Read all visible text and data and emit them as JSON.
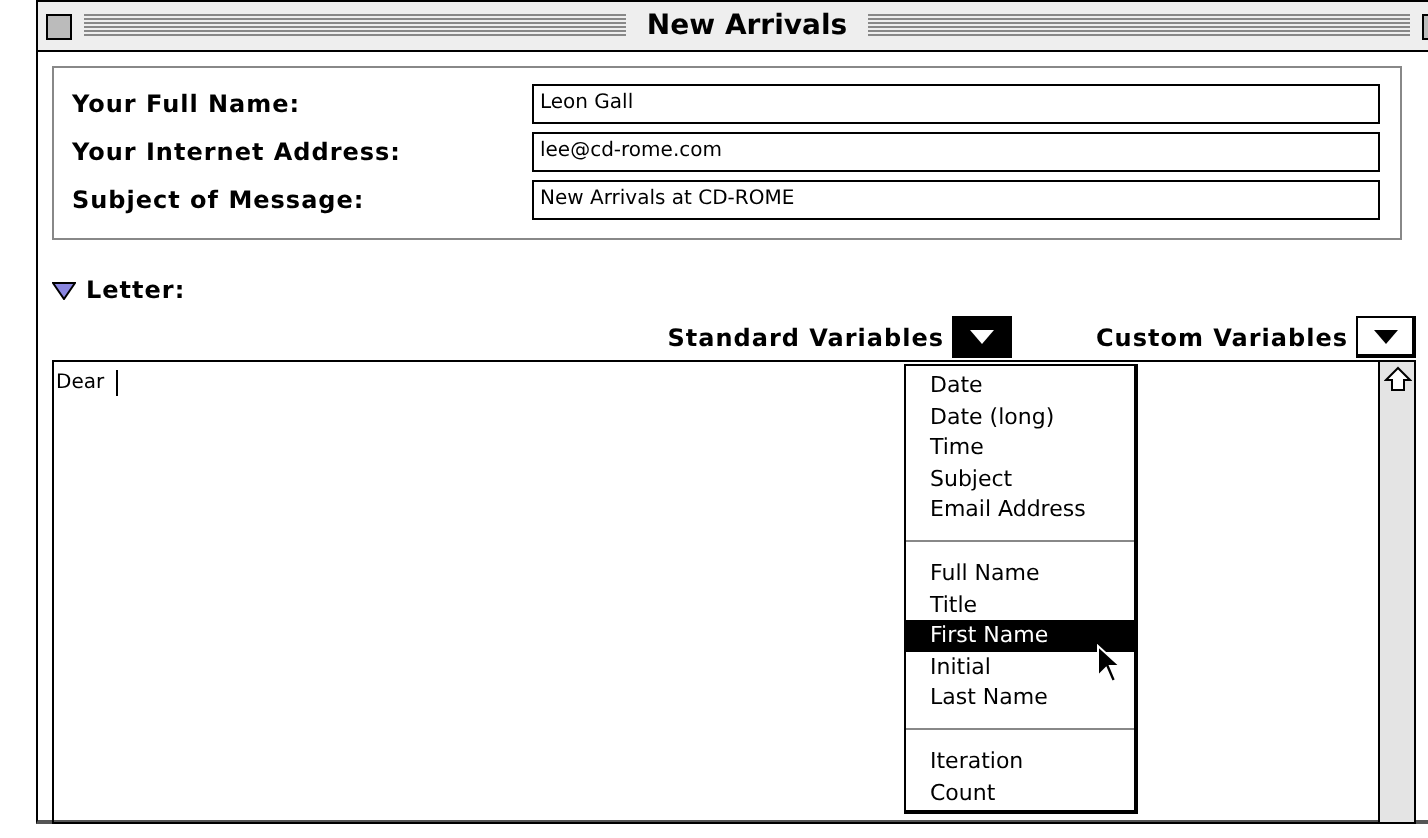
{
  "window": {
    "title": "New Arrivals"
  },
  "fields": [
    {
      "label": "Your Full Name:",
      "value": "Leon Gall"
    },
    {
      "label": "Your Internet Address:",
      "value": "lee@cd-rome.com"
    },
    {
      "label": "Subject of Message:",
      "value": "New Arrivals at CD-ROME"
    }
  ],
  "letter": {
    "label": "Letter:",
    "expanded": true,
    "value": "Dear"
  },
  "variables": [
    {
      "label": "Standard Variables",
      "open": true
    },
    {
      "label": "Custom Variables",
      "open": false
    }
  ],
  "menu": {
    "groups": [
      [
        {
          "label": "Date",
          "selected": false
        },
        {
          "label": "Date (long)",
          "selected": false
        },
        {
          "label": "Time",
          "selected": false
        },
        {
          "label": "Subject",
          "selected": false
        },
        {
          "label": "Email Address",
          "selected": false
        }
      ],
      [
        {
          "label": "Full Name",
          "selected": false
        },
        {
          "label": "Title",
          "selected": false
        },
        {
          "label": "First Name",
          "selected": true
        },
        {
          "label": "Initial",
          "selected": false
        },
        {
          "label": "Last Name",
          "selected": false
        }
      ],
      [
        {
          "label": "Iteration",
          "selected": false
        },
        {
          "label": "Count",
          "selected": false
        }
      ]
    ]
  }
}
